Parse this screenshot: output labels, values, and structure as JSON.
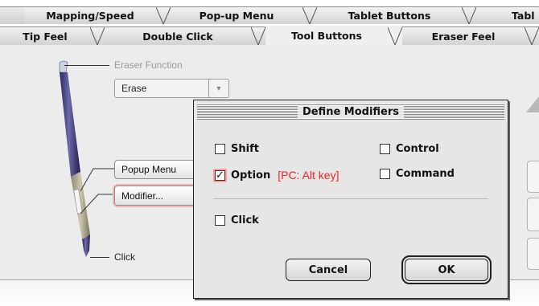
{
  "tabs_row1": [
    {
      "label": "Mapping/Speed"
    },
    {
      "label": "Pop-up Menu"
    },
    {
      "label": "Tablet Buttons"
    },
    {
      "label": "Tabl"
    }
  ],
  "tabs_row2": [
    {
      "label": "Tip Feel"
    },
    {
      "label": "Double Click"
    },
    {
      "label": "Tool Buttons",
      "active": true
    },
    {
      "label": "Eraser Feel"
    }
  ],
  "panel": {
    "eraser_function_label": "Eraser Function",
    "eraser_value": "Erase",
    "button_upper_value": "Popup Menu",
    "button_lower_value": "Modifier...",
    "tip_label": "Click"
  },
  "dialog": {
    "title": "Define Modifiers",
    "shift": {
      "label": "Shift",
      "checked": false
    },
    "control": {
      "label": "Control",
      "checked": false
    },
    "option": {
      "label": "Option",
      "checked": true,
      "hint": "[PC: Alt key]"
    },
    "command": {
      "label": "Command",
      "checked": false
    },
    "click": {
      "label": "Click",
      "checked": false
    },
    "cancel_label": "Cancel",
    "ok_label": "OK"
  },
  "icons": {
    "checkmark": "✓",
    "dropdown": "▼"
  },
  "colors": {
    "hint_red": "#ee2222",
    "highlight_pink": "#ff9c9c",
    "pen_dark": "#3a3770",
    "pen_grip": "#a79f83"
  }
}
